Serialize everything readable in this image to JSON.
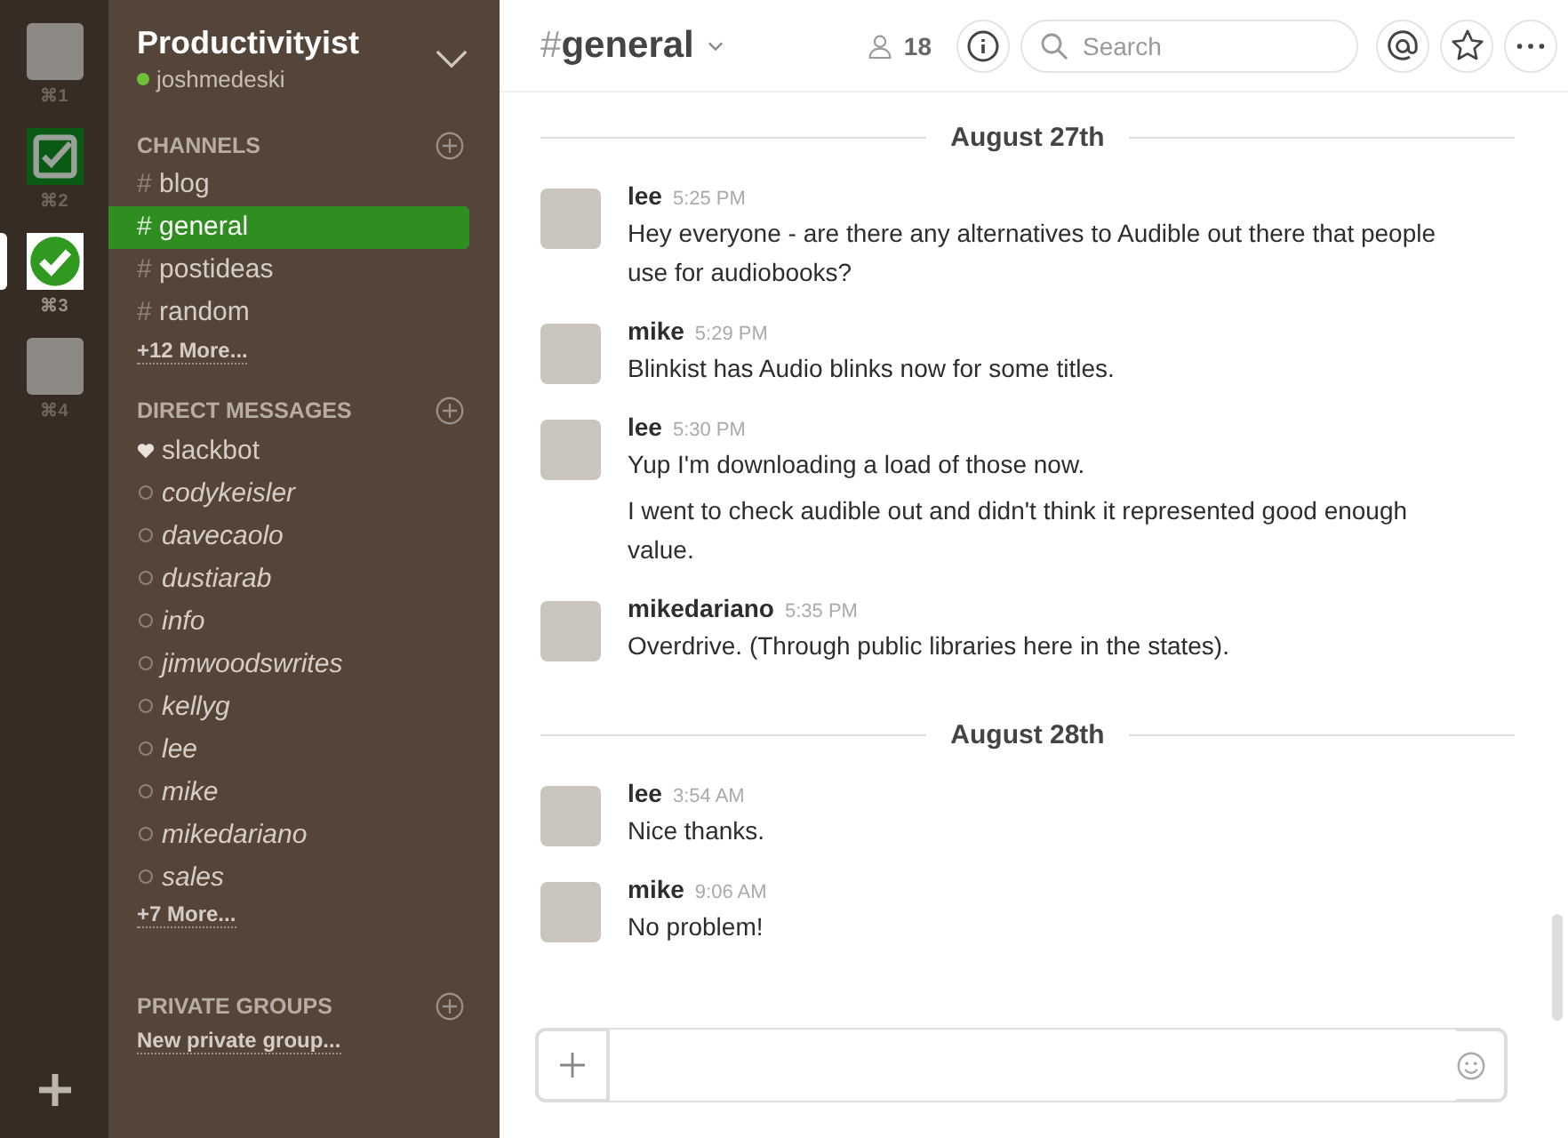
{
  "teams": [
    {
      "kind": "photo",
      "shortcut": "⌘1",
      "selected": false
    },
    {
      "kind": "check-square",
      "shortcut": "⌘2",
      "selected": false
    },
    {
      "kind": "check-circle",
      "shortcut": "⌘3",
      "selected": true
    },
    {
      "kind": "photo",
      "shortcut": "⌘4",
      "selected": false
    }
  ],
  "sidebar": {
    "team_name": "Productivityist",
    "user": {
      "name": "joshmedeski",
      "online": true
    },
    "channels": {
      "heading": "CHANNELS",
      "items": [
        {
          "prefix": "#",
          "name": "blog",
          "selected": false
        },
        {
          "prefix": "#",
          "name": "general",
          "selected": true
        },
        {
          "prefix": "#",
          "name": "postideas",
          "selected": false
        },
        {
          "prefix": "#",
          "name": "random",
          "selected": false
        }
      ],
      "more": "+12 More..."
    },
    "direct_messages": {
      "heading": "DIRECT MESSAGES",
      "items": [
        {
          "name": "slackbot",
          "kind": "bot"
        },
        {
          "name": "codykeisler",
          "kind": "user",
          "online": false
        },
        {
          "name": "davecaolo",
          "kind": "user",
          "online": false
        },
        {
          "name": "dustiarab",
          "kind": "user",
          "online": false
        },
        {
          "name": "info",
          "kind": "user",
          "online": false
        },
        {
          "name": "jimwoodswrites",
          "kind": "user",
          "online": false
        },
        {
          "name": "kellyg",
          "kind": "user",
          "online": false
        },
        {
          "name": "lee",
          "kind": "user",
          "online": false
        },
        {
          "name": "mike",
          "kind": "user",
          "online": false
        },
        {
          "name": "mikedariano",
          "kind": "user",
          "online": false
        },
        {
          "name": "sales",
          "kind": "user",
          "online": false
        }
      ],
      "more": "+7 More..."
    },
    "private_groups": {
      "heading": "PRIVATE GROUPS",
      "new": "New private group..."
    }
  },
  "header": {
    "hash": "#",
    "channel": "general",
    "members": "18",
    "search": {
      "placeholder": "Search"
    }
  },
  "days": [
    {
      "date": "August 27th",
      "messages": [
        {
          "author": "lee",
          "time": "5:25 PM",
          "lines": [
            "Hey everyone - are there any alternatives to Audible out there that people use for audiobooks?"
          ]
        },
        {
          "author": "mike",
          "time": "5:29 PM",
          "lines": [
            "Blinkist has Audio blinks now for some titles."
          ]
        },
        {
          "author": "lee",
          "time": "5:30 PM",
          "lines": [
            "Yup I'm downloading a load of those now.",
            "I went to check audible out and didn't think it represented good enough value."
          ]
        },
        {
          "author": "mikedariano",
          "time": "5:35 PM",
          "lines": [
            "Overdrive. (Through public libraries here in the states)."
          ]
        }
      ]
    },
    {
      "date": "August 28th",
      "messages": [
        {
          "author": "lee",
          "time": "3:54 AM",
          "lines": [
            "Nice thanks."
          ]
        },
        {
          "author": "mike",
          "time": "9:06 AM",
          "lines": [
            "No problem!"
          ]
        }
      ]
    }
  ]
}
